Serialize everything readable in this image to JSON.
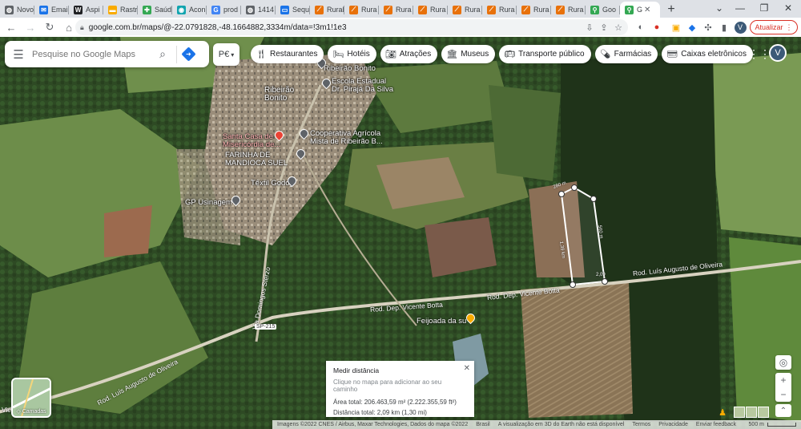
{
  "browser": {
    "tabs": [
      {
        "label": "Novo",
        "icon": "globe-icon",
        "color": "#5f6368"
      },
      {
        "label": "Emai",
        "icon": "mail-icon",
        "color": "#1a73e8"
      },
      {
        "label": "Aspi",
        "icon": "wp-icon",
        "color": "#202124"
      },
      {
        "label": "Rastr",
        "icon": "rastr-icon",
        "color": "#f9ab00"
      },
      {
        "label": "Saúd",
        "icon": "saude-icon",
        "color": "#34a853"
      },
      {
        "label": "Acon",
        "icon": "acon-icon",
        "color": "#12a4af"
      },
      {
        "label": "prod",
        "icon": "google-icon",
        "color": "#4285f4"
      },
      {
        "label": "1414",
        "icon": "globe-icon",
        "color": "#5f6368"
      },
      {
        "label": "Sequ",
        "icon": "seq-icon",
        "color": "#1a73e8"
      },
      {
        "label": "Rural",
        "icon": "rural-icon",
        "color": "#e8710a"
      },
      {
        "label": "Rura",
        "icon": "rural-icon",
        "color": "#e8710a"
      },
      {
        "label": "Rura",
        "icon": "rural-icon",
        "color": "#e8710a"
      },
      {
        "label": "Rura",
        "icon": "rural-icon",
        "color": "#e8710a"
      },
      {
        "label": "Rura",
        "icon": "rural-icon",
        "color": "#e8710a"
      },
      {
        "label": "Rura",
        "icon": "rural-icon",
        "color": "#e8710a"
      },
      {
        "label": "Rura",
        "icon": "rural-icon",
        "color": "#e8710a"
      },
      {
        "label": "Rura",
        "icon": "rural-icon",
        "color": "#e8710a"
      },
      {
        "label": "Goo",
        "icon": "maps-icon",
        "color": "#34a853"
      },
      {
        "label": "G",
        "icon": "maps-icon",
        "color": "#34a853",
        "active": true
      }
    ],
    "url": "google.com.br/maps/@-22.0791828,-48.1664882,3334m/data=!3m1!1e3",
    "update_label": "Atualizar",
    "profile_initial": "V"
  },
  "map": {
    "search_placeholder": "Pesquise no Google Maps",
    "lang_chip": "P€",
    "chips": [
      {
        "label": "Restaurantes",
        "icon": "fork-knife-icon"
      },
      {
        "label": "Hotéis",
        "icon": "bed-icon"
      },
      {
        "label": "Atrações",
        "icon": "camera-icon"
      },
      {
        "label": "Museus",
        "icon": "museum-icon"
      },
      {
        "label": "Transporte público",
        "icon": "bus-icon"
      },
      {
        "label": "Farmácias",
        "icon": "pill-icon"
      },
      {
        "label": "Caixas eletrônicos",
        "icon": "atm-icon"
      }
    ],
    "account_initial": "V",
    "places": {
      "ribeirao_bonito_top": "Ribeirão Bonito",
      "escola": "Escola Estadual\nDr. Pirajá Da Silva",
      "ribeirao_bonito": "Ribeirão\nBonito",
      "santa_casa": "Santa Casa de\nMisericórdia de...",
      "cooperativa": "Cooperativa Agrícola\nMista de Ribeirão B...",
      "farinha": "FARINHA DE\nMANDIOCA SUEL",
      "textil": "Têxtil Godoy",
      "gp": "GP Usinagem",
      "feijoada": "Feijoada da su"
    },
    "roads": {
      "luis_east": "Rod. Luís Augusto de Oliveira",
      "vicente_1": "Rod. Dep. Vicente Botta",
      "vicente_2": "Rod. Dep. Vicente Botta",
      "luis_west": "Rod. Luís Augusto de Oliveira",
      "domingos": "Via Domingos Sterzo",
      "sp215": "SP-215",
      "vic": "Vic"
    },
    "measure_edges": {
      "top": "280 m",
      "right": "560 m",
      "left": "1,39 km",
      "bottom": "2,09"
    },
    "measure": {
      "title": "Medir distância",
      "hint": "Clique no mapa para adicionar ao seu caminho",
      "area": "Área total: 206.463,59 m² (2.222.355,59 ft²)",
      "distance": "Distância total: 2,09 km (1,30 mi)"
    },
    "layers_label": "Camadas",
    "footer": {
      "credits": "Imagens ©2022 CNES / Airbus, Maxar Technologies, Dados do mapa ©2022",
      "country": "Brasil",
      "notice": "A visualização em 3D do Earth não está disponível",
      "terms": "Termos",
      "privacy": "Privacidade",
      "feedback": "Enviar feedback",
      "scale": "500 m"
    }
  }
}
